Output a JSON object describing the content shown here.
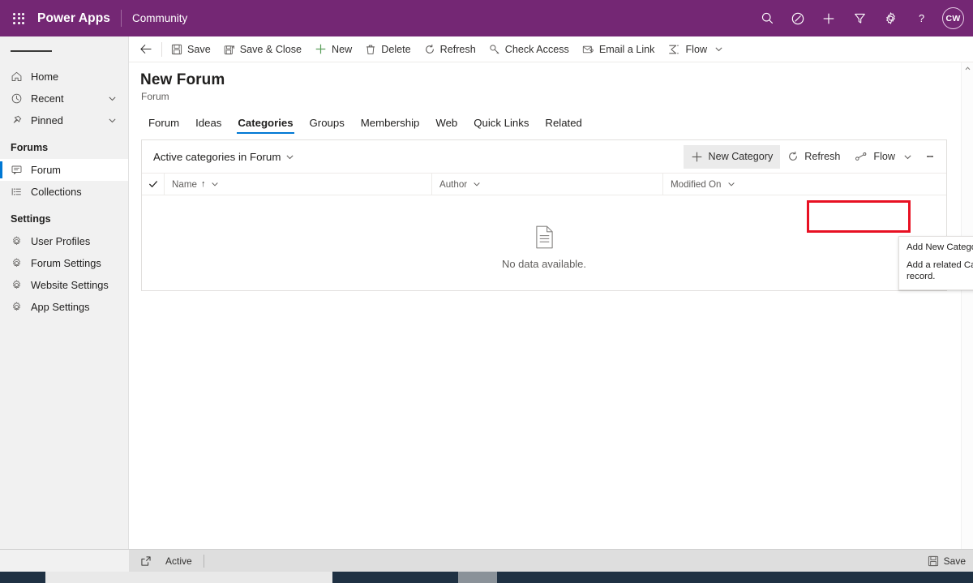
{
  "header": {
    "waffle_icon": "waffle-icon",
    "brand": "Power Apps",
    "app_name": "Community",
    "icons": [
      {
        "name": "search-icon",
        "label": "Search"
      },
      {
        "name": "assistant-icon",
        "label": "Assistant"
      },
      {
        "name": "new-icon",
        "label": "New"
      },
      {
        "name": "filter-icon",
        "label": "Filter"
      },
      {
        "name": "settings-gear-icon",
        "label": "Settings"
      },
      {
        "name": "help-icon",
        "label": "Help"
      }
    ],
    "avatar_initials": "CW",
    "background_color": "#742774"
  },
  "sidebar": {
    "hamburger_label": "Site map",
    "items": [
      {
        "label": "Home",
        "icon": "home-icon",
        "chevron": false,
        "selected": false
      },
      {
        "label": "Recent",
        "icon": "clock-icon",
        "chevron": true,
        "selected": false
      },
      {
        "label": "Pinned",
        "icon": "pin-icon",
        "chevron": true,
        "selected": false
      }
    ],
    "groups": [
      {
        "title": "Forums",
        "items": [
          {
            "label": "Forum",
            "icon": "forum-icon",
            "selected": true
          },
          {
            "label": "Collections",
            "icon": "collections-icon",
            "selected": false
          }
        ]
      },
      {
        "title": "Settings",
        "items": [
          {
            "label": "User Profiles",
            "icon": "gear-icon",
            "selected": false
          },
          {
            "label": "Forum Settings",
            "icon": "gear-icon",
            "selected": false
          },
          {
            "label": "Website Settings",
            "icon": "gear-icon",
            "selected": false
          },
          {
            "label": "App Settings",
            "icon": "gear-icon",
            "selected": false
          }
        ]
      }
    ]
  },
  "commandbar": {
    "back_label": "Back",
    "buttons": [
      {
        "label": "Save",
        "icon": "save-icon"
      },
      {
        "label": "Save & Close",
        "icon": "save-close-icon"
      },
      {
        "label": "New",
        "icon": "plus-icon"
      },
      {
        "label": "Delete",
        "icon": "trash-icon"
      },
      {
        "label": "Refresh",
        "icon": "refresh-icon"
      },
      {
        "label": "Check Access",
        "icon": "key-icon"
      },
      {
        "label": "Email a Link",
        "icon": "email-icon"
      },
      {
        "label": "Flow",
        "icon": "flow-icon",
        "caret": true
      }
    ]
  },
  "record": {
    "title": "New Forum",
    "subtitle": "Forum"
  },
  "tabs": [
    {
      "label": "Forum",
      "active": false
    },
    {
      "label": "Ideas",
      "active": false
    },
    {
      "label": "Categories",
      "active": true
    },
    {
      "label": "Groups",
      "active": false
    },
    {
      "label": "Membership",
      "active": false
    },
    {
      "label": "Web",
      "active": false
    },
    {
      "label": "Quick Links",
      "active": false
    },
    {
      "label": "Related",
      "active": false
    }
  ],
  "subgrid": {
    "view_name": "Active categories in Forum",
    "commands": [
      {
        "label": "New Category",
        "icon": "plus-icon",
        "highlighted": true
      },
      {
        "label": "Refresh",
        "icon": "refresh-icon",
        "highlighted": false
      },
      {
        "label": "Flow",
        "icon": "flow-node-icon",
        "caret": true,
        "highlighted": false
      }
    ],
    "more_commands_label": "More commands",
    "columns": [
      {
        "label": "Name",
        "sort": "↑",
        "chevron": true
      },
      {
        "label": "Author",
        "sort": "",
        "chevron": true
      },
      {
        "label": "Modified On",
        "sort": "",
        "chevron": true
      }
    ],
    "select_all_label": "Select all",
    "empty_state": {
      "icon": "no-data-document-icon",
      "message": "No data available."
    }
  },
  "tooltip": {
    "title": "Add New Category",
    "description": "Add a related Category to this record."
  },
  "statusbar": {
    "expand_icon": "popout-icon",
    "state": "Active",
    "save_label": "Save",
    "save_icon": "save-icon"
  },
  "colors": {
    "brand_purple": "#742774",
    "accent_blue": "#0078d4",
    "highlight_red": "#e81123"
  }
}
